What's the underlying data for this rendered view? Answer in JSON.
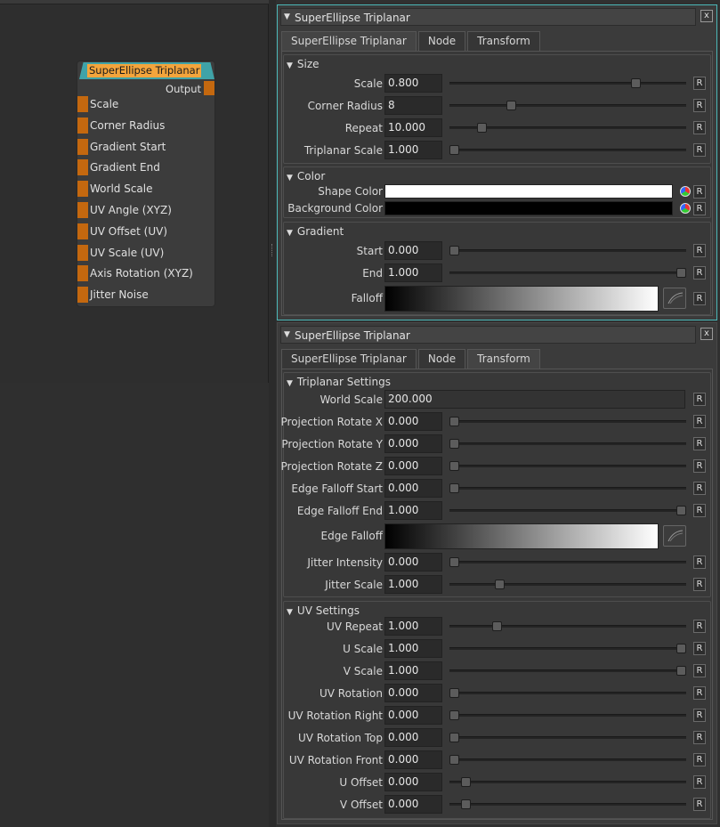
{
  "node": {
    "title": "SuperEllipse Triplanar",
    "output_label": "Output",
    "inputs": [
      "Scale",
      "Corner Radius",
      "Gradient Start",
      "Gradient End",
      "World Scale",
      "UV Angle (XYZ)",
      "UV Offset (UV)",
      "UV Scale (UV)",
      "Axis Rotation (XYZ)",
      "Jitter Noise"
    ]
  },
  "panel1": {
    "title": "SuperEllipse Triplanar",
    "close_label": "x",
    "tabs": [
      "SuperEllipse Triplanar",
      "Node",
      "Transform"
    ],
    "active_tab": "SuperEllipse Triplanar",
    "size": {
      "heading": "Size",
      "rows": [
        {
          "label": "Scale",
          "value": "0.800",
          "level": 0.8
        },
        {
          "label": "Corner Radius",
          "value": "8",
          "level": 0.25
        },
        {
          "label": "Repeat",
          "value": "10.000",
          "level": 0.12
        },
        {
          "label": "Triplanar Scale",
          "value": "1.000",
          "level": 0.0
        }
      ]
    },
    "color": {
      "heading": "Color",
      "rows": [
        {
          "label": "Shape Color",
          "color": "#ffffff"
        },
        {
          "label": "Background Color",
          "color": "#000000"
        }
      ]
    },
    "gradient": {
      "heading": "Gradient",
      "start": {
        "label": "Start",
        "value": "0.000",
        "level": 0.0
      },
      "end": {
        "label": "End",
        "value": "1.000",
        "level": 1.0
      },
      "falloff_label": "Falloff"
    },
    "reset_label": "R"
  },
  "panel2": {
    "title": "SuperEllipse Triplanar",
    "close_label": "x",
    "tabs": [
      "SuperEllipse Triplanar",
      "Node",
      "Transform"
    ],
    "active_tab": "Transform",
    "triplanar": {
      "heading": "Triplanar Settings",
      "world_scale": {
        "label": "World Scale",
        "value": "200.000"
      },
      "rows": [
        {
          "label": "Projection Rotate X",
          "value": "0.000",
          "level": 0.0
        },
        {
          "label": "Projection Rotate Y",
          "value": "0.000",
          "level": 0.0
        },
        {
          "label": "Projection Rotate Z",
          "value": "0.000",
          "level": 0.0
        },
        {
          "label": "Edge Falloff Start",
          "value": "0.000",
          "level": 0.0
        },
        {
          "label": "Edge Falloff End",
          "value": "1.000",
          "level": 1.0
        }
      ],
      "edge_falloff_label": "Edge Falloff",
      "rows2": [
        {
          "label": "Jitter Intensity",
          "value": "0.000",
          "level": 0.0
        },
        {
          "label": "Jitter Scale",
          "value": "1.000",
          "level": 0.2
        }
      ]
    },
    "uv": {
      "heading": "UV Settings",
      "rows": [
        {
          "label": "UV Repeat",
          "value": "1.000",
          "level": 0.19
        },
        {
          "label": "U Scale",
          "value": "1.000",
          "level": 1.0
        },
        {
          "label": "V Scale",
          "value": "1.000",
          "level": 1.0
        },
        {
          "label": "UV Rotation",
          "value": "0.000",
          "level": 0.0
        },
        {
          "label": "UV Rotation Right",
          "value": "0.000",
          "level": 0.0
        },
        {
          "label": "UV Rotation Top",
          "value": "0.000",
          "level": 0.0
        },
        {
          "label": "UV Rotation Front",
          "value": "0.000",
          "level": 0.0
        },
        {
          "label": "U Offset",
          "value": "0.000",
          "level": 0.05
        },
        {
          "label": "V Offset",
          "value": "0.000",
          "level": 0.05
        }
      ]
    },
    "reset_label": "R"
  }
}
